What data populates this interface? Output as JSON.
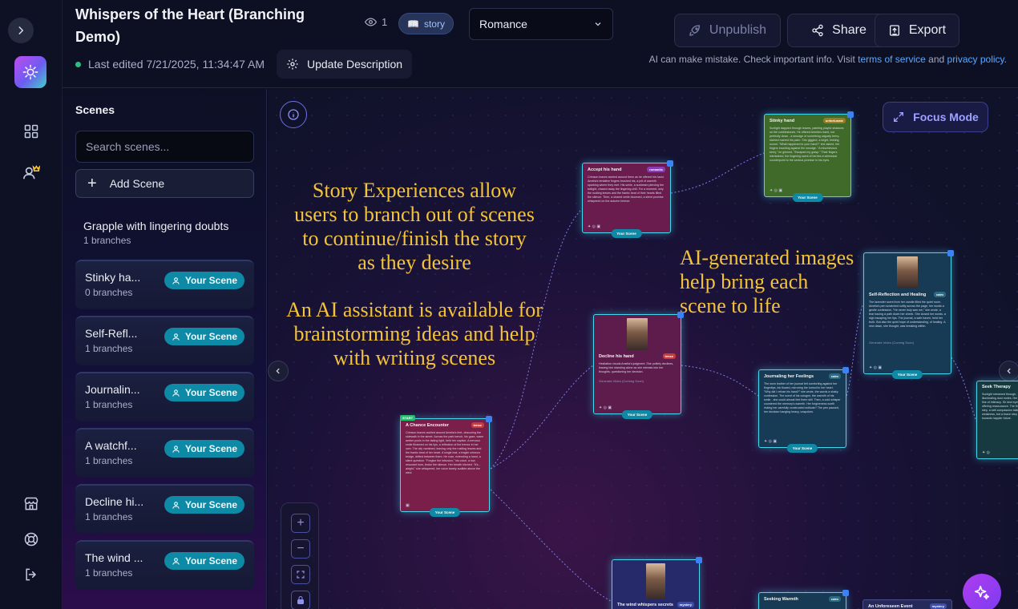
{
  "header": {
    "title": "Whispers of the Heart (Branching Demo)",
    "last_edited": "Last edited 7/21/2025, 11:34:47 AM",
    "update_description": "Update Description",
    "views": "1",
    "tag": "story",
    "genre": "Romance",
    "unpublish": "Unpublish",
    "share": "Share",
    "export": "Export",
    "disclaimer_prefix": "AI can make mistake. Check important info. Visit ",
    "tos": "terms of service",
    "and": " and ",
    "privacy": "privacy policy",
    "period": "."
  },
  "scenes": {
    "heading": "Scenes",
    "search_placeholder": "Search scenes...",
    "add_scene": "Add Scene",
    "your_scene_label": "Your Scene",
    "first": {
      "name": "Grapple with lingering doubts",
      "branches": "1 branches"
    },
    "items": [
      {
        "name": "Stinky ha...",
        "branches": "0 branches"
      },
      {
        "name": "Self-Refl...",
        "branches": "1 branches"
      },
      {
        "name": "Journalin...",
        "branches": "1 branches"
      },
      {
        "name": "A watchf...",
        "branches": "1 branches"
      },
      {
        "name": "Decline hi...",
        "branches": "1 branches"
      },
      {
        "name": "The wind ...",
        "branches": "1 branches"
      }
    ]
  },
  "canvas": {
    "focus_mode": "Focus Mode",
    "overlay_left_1": "Story Experiences allow users to branch out of scenes to continue/finish the story as they desire",
    "overlay_left_2": "An AI assistant is available for brainstorming ideas and help with writing scenes",
    "overlay_right": "AI-generated images help bring each scene to life",
    "nodes": {
      "start": "START",
      "encounter": {
        "title": "A Chance Encounter",
        "tag": "tense",
        "text": "Crimson leaves swirled around Amelia's feet, obscuring the sidewalk in the street. Across the park bench, his gaze, warm amber pools in the fading light, held her captive. A nervous smile flickered on his lips, a reflection of the tremor in her own. The city vanished, leaving only the rustling leaves and the frantic beat of her heart. A single leaf, a fragile crimson bridge, drifted between them. He rose, extending a hand, a silent question. \"Forgive the intrusion,\" his voice, a low, resonant hum, broke the silence. Her breath hitched. \"It's... alright,\" she whispered, her voice barely audible above the wind."
      },
      "accept": {
        "title": "Accept his hand",
        "tag": "romantic",
        "text": "Crimson leaves swirled around them as he offered his hand. Amelia's tentative fingers brushed his, a jolt of warmth sparking where they met. His smile, a sunbeam piercing the twilight, chased away the lingering chill. For a moment, only the rustling leaves and the frantic beat of their hearts filled the silence. Then, a shared smile bloomed, a silent promise whispered on the autumn breeze."
      },
      "decline": {
        "title": "Decline his hand",
        "tag": "tense",
        "text": "Hesitation clouds Amelia's judgment. She politely declines, leaving him standing alone as she retreats into her thoughts, questioning her decision.",
        "video": "Generate Video",
        "video_sub": "(Coming Soon)"
      },
      "wind": {
        "title": "The wind whispers secrets",
        "tag": "mystery"
      },
      "stinky": {
        "title": "Stinky hand",
        "tag": "unfortunate",
        "text": "Sunlight dappled through leaves, painting playful shadows on the cobblestones. He offered Amelia's hand, not perfectly clean - a smudge of something vaguely berry-stained marred his palm. She giggled, a bright, tinkling sound. \"What happened to your hand?\" she asked, her fingers brushing against the smudge. \"A mischievous berry,\" he grinned, \"Escaped my grasp.\" Their fingers intertwined, the lingering scent of berries a whimsical counterpoint to the serious promise in his eyes."
      },
      "journal": {
        "title": "Journaling her Feelings",
        "tag": "calm",
        "text": "The worn leather of her journal felt comforting against her fingertips, ink flowed, mirroring the turmoil in her heart. \"Why did I refuse his hand?\" she wrote, the words a shaky confession. The scent of his cologne, the warmth of his smile - she could almost feel them still. Then, a cold whisper countered the memory's warmth. Her forgiveness worth risking her carefully constructed solitude? The pen paused, her decision hanging heavy, unspoken."
      },
      "reflect": {
        "title": "Self-Reflection and Healing",
        "tag": "calm",
        "text": "The lavender scent from her candle filled the quiet room. Amelia's pen scratched softly across the page, her words a gentle confession. \"He never truly saw me,\" she wrote, a tear tracing a path down her cheek. She closed her words, a sigh escaping her lips. The journal, a safe haven, held her truth. But also the quiet hope of understanding, of healing. A new dawn, she thought, was breaking within.",
        "video": "Generate Video",
        "video_sub": "(Coming Soon)"
      },
      "seek": {
        "title": "Seek Therapy",
        "text": "Sunlight streamed through, illuminating dust motes. Her first fine of intimacy. Sh kind eyes offering reassurance. The first step, a self-compassion taking weakness, but a brave step towards happier future."
      },
      "warmth": {
        "title": "Seeking Warmth",
        "tag": "calm"
      },
      "unforeseen": {
        "title": "An Unforeseen Event",
        "tag": "mystery"
      }
    }
  },
  "colors": {
    "accent": "#0e8aa6",
    "node_border": "#46d7ef",
    "overlay_text": "#f3c33a",
    "link": "#5aa8ff",
    "status_dot": "#28c081"
  },
  "icons": [
    "chevron-right-icon",
    "dashboard-icon",
    "user-crown-icon",
    "store-icon",
    "lifebuoy-icon",
    "logout-icon",
    "eye-icon",
    "book-icon",
    "chevron-down-icon",
    "gear-icon",
    "rocket-icon",
    "share-icon",
    "export-icon",
    "plus-icon",
    "user-icon",
    "info-icon",
    "expand-icon",
    "minus-icon",
    "fit-view-icon",
    "lock-icon",
    "sparkle-icon"
  ]
}
